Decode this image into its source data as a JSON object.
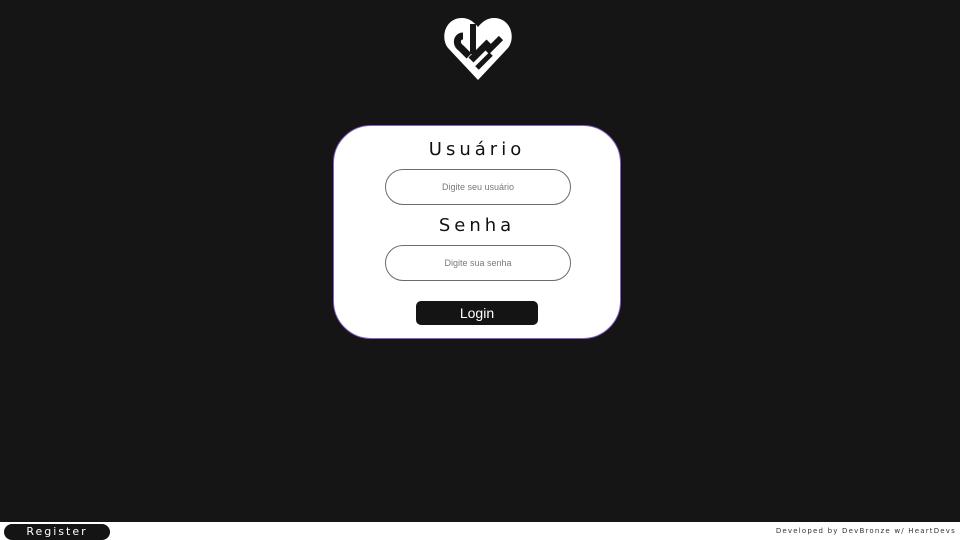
{
  "brand": {
    "logo_icon": "heart-devs-logo-icon"
  },
  "login_card": {
    "user_label": "Usuário",
    "user_placeholder": "Digite seu usuário",
    "password_label": "Senha",
    "password_placeholder": "Digite sua senha",
    "login_label": "Login"
  },
  "footer": {
    "register_label": "Register",
    "credits": "Developed by DevBronze w/ HeartDevs"
  },
  "colors": {
    "background": "#151515",
    "card": "#ffffff",
    "card_border": "#8a5cc7",
    "button": "#141414"
  }
}
